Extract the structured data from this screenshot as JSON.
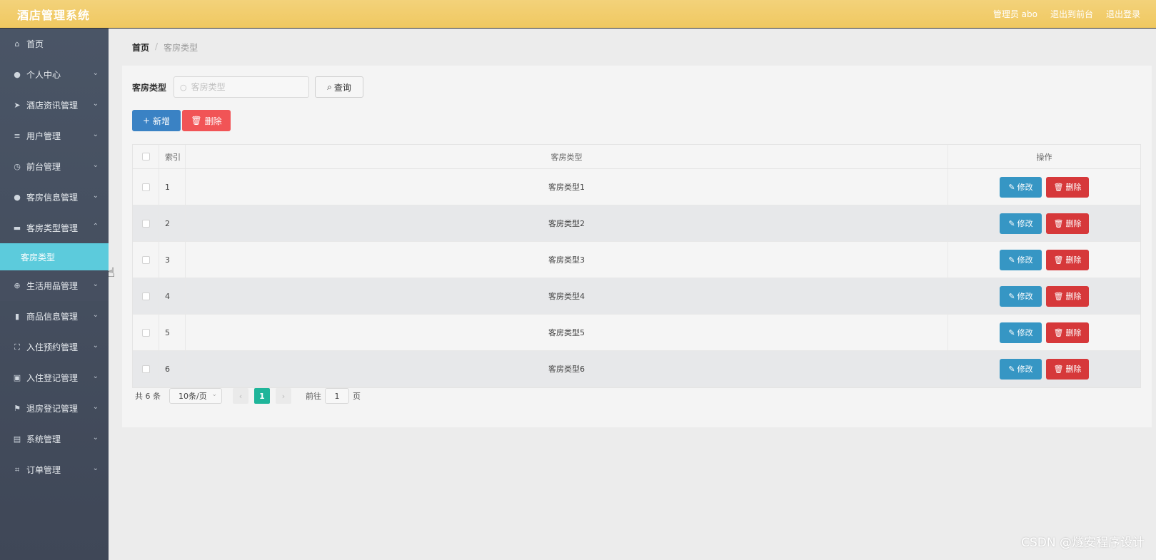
{
  "app": {
    "title": "酒店管理系统",
    "top_links": [
      "管理员 abo",
      "退出到前台",
      "退出登录"
    ]
  },
  "sidebar": {
    "items": [
      {
        "label": "首页",
        "icon": "home-icon",
        "glyph": "⌂",
        "chevron": ""
      },
      {
        "label": "个人中心",
        "icon": "user-icon",
        "glyph": "●",
        "chevron": "⌄"
      },
      {
        "label": "酒店资讯管理",
        "icon": "send-icon",
        "glyph": "➤",
        "chevron": "⌄"
      },
      {
        "label": "用户管理",
        "icon": "sliders-icon",
        "glyph": "≡",
        "chevron": "⌄"
      },
      {
        "label": "前台管理",
        "icon": "check-circle-icon",
        "glyph": "◷",
        "chevron": "⌄"
      },
      {
        "label": "客房信息管理",
        "icon": "user-icon",
        "glyph": "●",
        "chevron": "⌄"
      },
      {
        "label": "客房类型管理",
        "icon": "printer-icon",
        "glyph": "▬",
        "chevron": "⌃"
      }
    ],
    "submenu": {
      "label": "客房类型"
    },
    "items_after": [
      {
        "label": "生活用品管理",
        "icon": "lifebuoy-icon",
        "glyph": "⊕",
        "chevron": "⌄"
      },
      {
        "label": "商品信息管理",
        "icon": "bars-icon",
        "glyph": "▮",
        "chevron": "⌄"
      },
      {
        "label": "入住预约管理",
        "icon": "fullscreen-icon",
        "glyph": "⛶",
        "chevron": "⌄"
      },
      {
        "label": "入住登记管理",
        "icon": "briefcase-icon",
        "glyph": "▣",
        "chevron": "⌄"
      },
      {
        "label": "退房登记管理",
        "icon": "flag-icon",
        "glyph": "⚑",
        "chevron": "⌄"
      },
      {
        "label": "系统管理",
        "icon": "clipboard-icon",
        "glyph": "▤",
        "chevron": "⌄"
      },
      {
        "label": "订单管理",
        "icon": "crop-icon",
        "glyph": "⌗",
        "chevron": "⌄"
      }
    ]
  },
  "breadcrumb": {
    "home": "首页",
    "sep": "/",
    "current": "客房类型"
  },
  "search": {
    "label": "客房类型",
    "placeholder": "客房类型",
    "value": "",
    "button": "查询"
  },
  "actions": {
    "add": "新增",
    "delete": "删除"
  },
  "table": {
    "headers": {
      "index": "索引",
      "type": "客房类型",
      "ops": "操作"
    },
    "rows": [
      {
        "index": "1",
        "type": "客房类型1"
      },
      {
        "index": "2",
        "type": "客房类型2"
      },
      {
        "index": "3",
        "type": "客房类型3"
      },
      {
        "index": "4",
        "type": "客房类型4"
      },
      {
        "index": "5",
        "type": "客房类型5"
      },
      {
        "index": "6",
        "type": "客房类型6"
      }
    ],
    "edit_label": "修改",
    "delete_label": "删除"
  },
  "pagination": {
    "total": "共 6 条",
    "page_size": "10条/页",
    "current_page": "1",
    "goto_label": "前往",
    "goto_value": "1",
    "page_unit": "页"
  },
  "watermark": "CSDN @燧安程序设计"
}
